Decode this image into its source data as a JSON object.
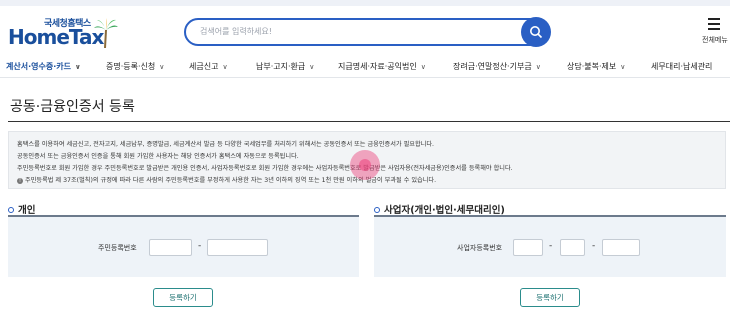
{
  "header": {
    "logo_small": "국세청홈택스",
    "logo_main": "HomeTax",
    "search_placeholder": "검색어를 입력하세요!",
    "all_menu_label": "전체메뉴"
  },
  "nav": {
    "items": [
      {
        "label": "계산서·영수증·카드",
        "active": true
      },
      {
        "label": "증명·등록·신청",
        "active": false
      },
      {
        "label": "세금신고",
        "active": false
      },
      {
        "label": "납부·고지·환급",
        "active": false
      },
      {
        "label": "지급명세·자료·공익법인",
        "active": false
      },
      {
        "label": "장려금·연말정산·기부금",
        "active": false
      },
      {
        "label": "상담·불복·제보",
        "active": false
      },
      {
        "label": "세무대리·납세관리",
        "active": false
      }
    ]
  },
  "page": {
    "title": "공동·금융인증서 등록"
  },
  "info": {
    "lines": [
      "홈택스를 이용하여 세금신고, 전자고지, 세금납부, 증명발급, 세금계산서 발급 등 다양한 국세업무를 처리하기 위해서는 공동인증서 또는 금융인증서가 필요합니다.",
      "공동인증서 또는 금융인증서 인증을 통해 회원 가입한 사용자는 해당 인증서가 홈택스에 자동으로 등록됩니다.",
      "주민등록번호로 회원 가입한 경우 주민등록번호로 발급받은 개인용 인증서, 사업자등록번호로 회원 가입한 경우에는 사업자등록번호로 발급받은 사업자용(전자세금용)인증서를 등록해야 합니다.",
      "주민등록법 제 37조(벌칙)의 규정에 따라 다른 사람의 주민등록번호를 부정하게 사용한 자는 3년 이하의 징역 또는 1천 만원 이하의 벌금이 부과될 수 있습니다."
    ]
  },
  "personal": {
    "section_title": "개인",
    "field_label": "주민등록번호",
    "dash": "-",
    "button": "등록하기"
  },
  "business": {
    "section_title": "사업자(개인·법인·세무대리인)",
    "field_label": "사업자등록번호",
    "dash1": "-",
    "dash2": "-",
    "button": "등록하기"
  },
  "colors": {
    "brand": "#1a4f9c",
    "search_border": "#2a5fc4",
    "button_border": "#2b8c8c",
    "panel_bg": "#eef3f8"
  }
}
